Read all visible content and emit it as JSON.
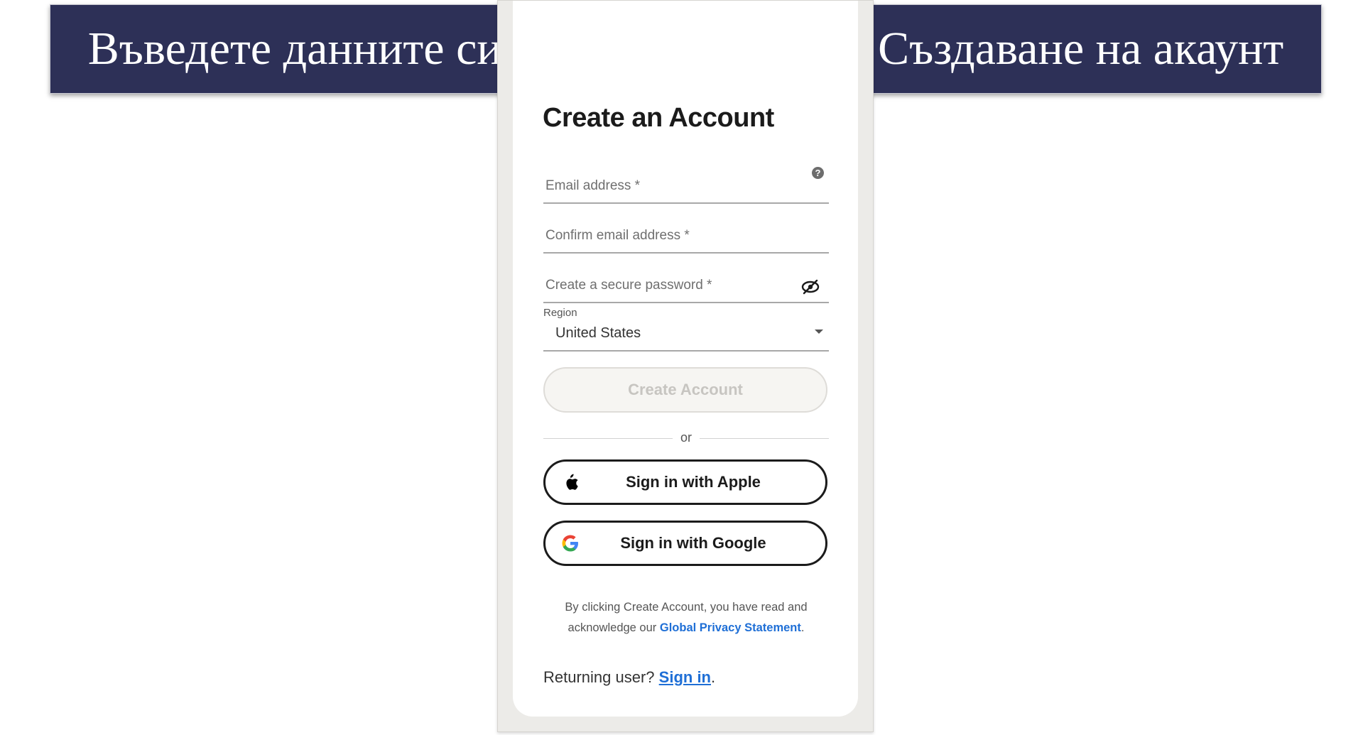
{
  "banner": {
    "text": "Въведете данните си и щракнете върху Създаване на акаунт"
  },
  "form": {
    "title": "Create an Account",
    "email_placeholder": "Email address *",
    "confirm_email_placeholder": "Confirm email address *",
    "password_placeholder": "Create a secure password *",
    "region_label": "Region",
    "region_value": "United States",
    "create_button": "Create Account",
    "divider_text": "or",
    "apple_button": "Sign in with Apple",
    "google_button": "Sign in with Google",
    "legal_prefix": "By clicking Create Account, you have read and acknowledge our",
    "legal_link": "Global Privacy Statement",
    "legal_suffix": ".",
    "returning_prefix": "Returning user?",
    "returning_link": "Sign in",
    "returning_suffix": "."
  },
  "icons": {
    "help": "help-circle-icon",
    "password_toggle": "eye-off-icon",
    "dropdown": "caret-down-icon",
    "apple": "apple-logo-icon",
    "google": "google-logo-icon"
  },
  "colors": {
    "banner_bg": "#2d3057",
    "link": "#1f6fd6",
    "text_dark": "#1b1b1b",
    "disabled_text": "#c7c5c1"
  }
}
